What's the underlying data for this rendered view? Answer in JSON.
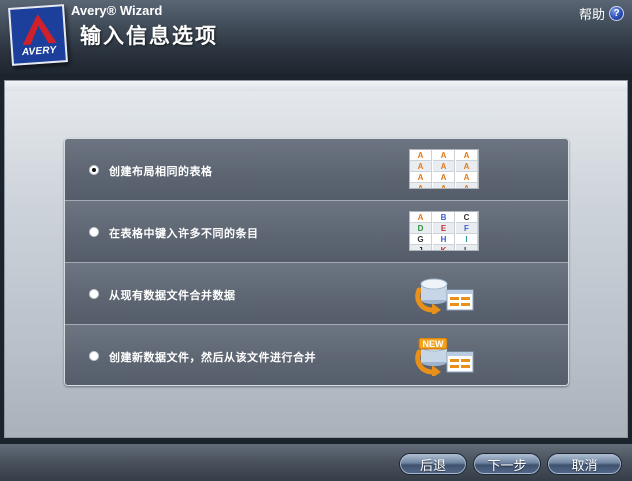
{
  "header": {
    "logo_text": "AVERY",
    "app_name": "Avery® Wizard",
    "page_title": "输入信息选项",
    "help_label": "帮助",
    "help_icon_glyph": "?"
  },
  "options": [
    {
      "label": "创建布局相同的表格",
      "selected": true,
      "icon": "uniform-grid-icon"
    },
    {
      "label": "在表格中键入许多不同的条目",
      "selected": false,
      "icon": "varied-grid-icon"
    },
    {
      "label": "从现有数据文件合并数据",
      "selected": false,
      "icon": "database-merge-icon"
    },
    {
      "label": "创建新数据文件，然后从该文件进行合并",
      "selected": false,
      "icon": "new-database-merge-icon"
    }
  ],
  "grid_uniform": {
    "cells": [
      "A",
      "A",
      "A",
      "A",
      "A",
      "A",
      "A",
      "A",
      "A",
      "A",
      "A",
      "A"
    ],
    "color": "#e07a1a"
  },
  "grid_varied": {
    "cells": [
      "A",
      "B",
      "C",
      "D",
      "E",
      "F",
      "G",
      "H",
      "I",
      "J",
      "K",
      "L"
    ],
    "colors": [
      "#e07a1a",
      "#3a5fd0",
      "#333333",
      "#2f8f3a",
      "#c03030",
      "#3a5fd0",
      "#333333",
      "#3a5fd0",
      "#2f9a9a",
      "#333333",
      "#c03030",
      "#333333"
    ]
  },
  "new_badge": "NEW",
  "footer": {
    "back_label": "后退",
    "next_label": "下一步",
    "cancel_label": "取消"
  },
  "colors": {
    "header_bg": "#3f4a57",
    "logo_blue": "#1d3f9c",
    "avery_red": "#d0202a",
    "option_bg": "#5d6672",
    "help_blue": "#2a4fb8"
  }
}
